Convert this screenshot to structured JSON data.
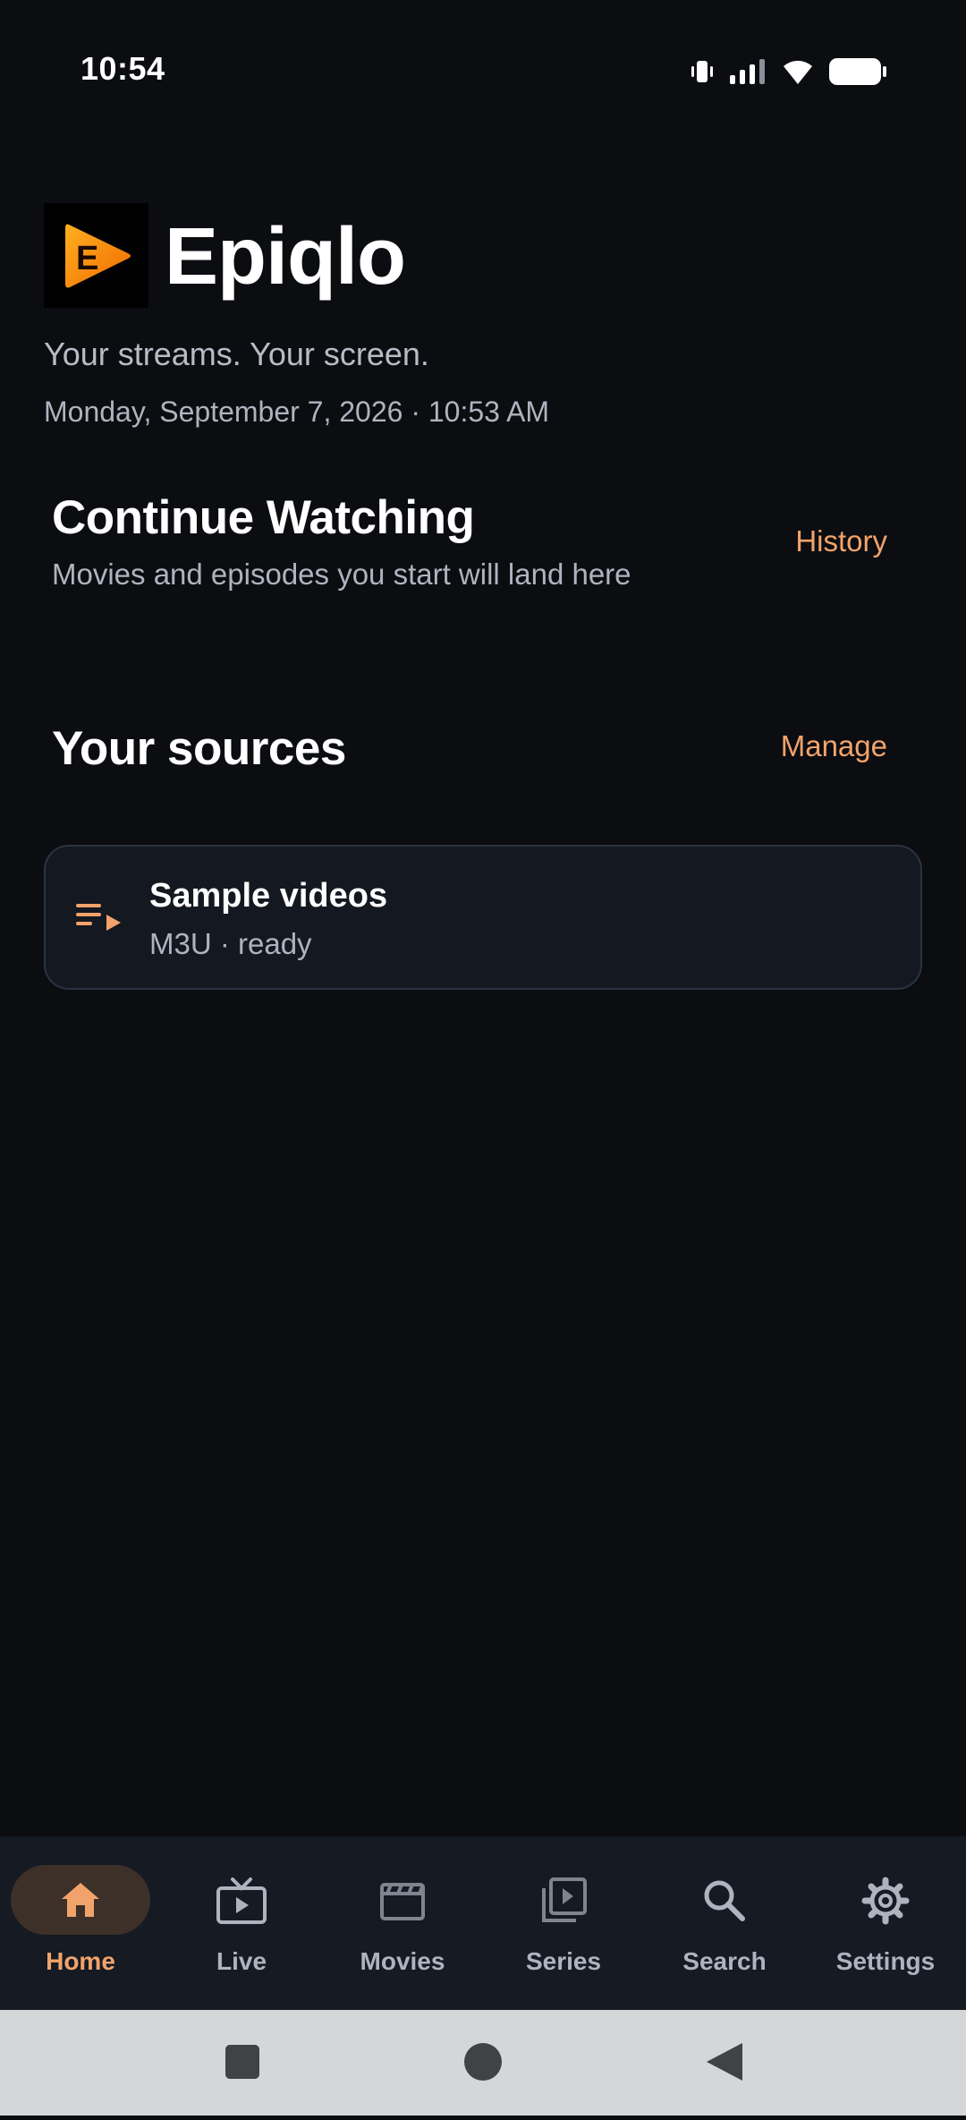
{
  "status_bar": {
    "time": "10:54",
    "icons": [
      "vibrate-icon",
      "signal-icon",
      "wifi-icon",
      "battery-icon"
    ]
  },
  "header": {
    "app_name": "Epiqlo",
    "logo_letter": "E",
    "tagline": "Your streams. Your screen.",
    "datetime": "Monday, September 7, 2026 · 10:53 AM"
  },
  "continue_watching": {
    "title": "Continue Watching",
    "subtitle": "Movies and episodes you start will land here",
    "action": "History"
  },
  "sources": {
    "title": "Your sources",
    "action": "Manage",
    "items": [
      {
        "name": "Sample videos",
        "meta": "M3U · ready",
        "icon": "playlist-play-icon"
      }
    ]
  },
  "bottom_nav": {
    "items": [
      {
        "label": "Home",
        "icon": "home-icon",
        "active": true
      },
      {
        "label": "Live",
        "icon": "tv-icon",
        "active": false
      },
      {
        "label": "Movies",
        "icon": "clapperboard-icon",
        "active": false
      },
      {
        "label": "Series",
        "icon": "video-library-icon",
        "active": false
      },
      {
        "label": "Search",
        "icon": "search-icon",
        "active": false
      },
      {
        "label": "Settings",
        "icon": "gear-icon",
        "active": false
      }
    ]
  },
  "colors": {
    "background": "#0b0d11",
    "accent": "#f2a36b",
    "card": "#141820",
    "nav_background": "#151a23"
  }
}
